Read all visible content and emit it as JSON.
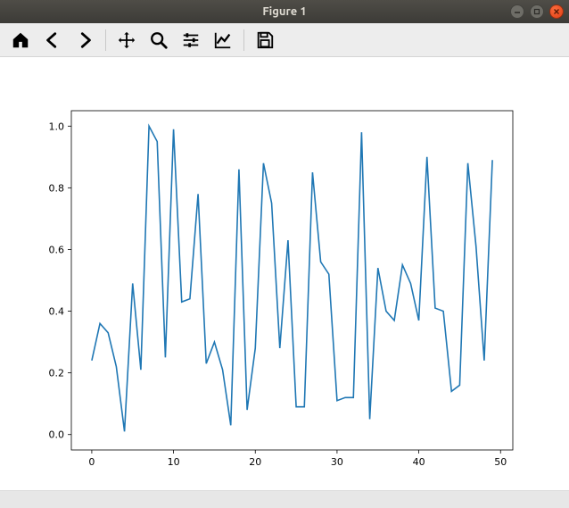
{
  "window": {
    "title": "Figure 1"
  },
  "toolbar": {
    "home_tip": "Home",
    "back_tip": "Back",
    "forward_tip": "Forward",
    "pan_tip": "Pan",
    "zoom_tip": "Zoom",
    "subplots_tip": "Configure subplots",
    "axes_tip": "Edit axis",
    "save_tip": "Save"
  },
  "chart_data": {
    "type": "line",
    "x": [
      0,
      1,
      2,
      3,
      4,
      5,
      6,
      7,
      8,
      9,
      10,
      11,
      12,
      13,
      14,
      15,
      16,
      17,
      18,
      19,
      20,
      21,
      22,
      23,
      24,
      25,
      26,
      27,
      28,
      29,
      30,
      31,
      32,
      33,
      34,
      35,
      36,
      37,
      38,
      39,
      40,
      41,
      42,
      43,
      44,
      45,
      46,
      47,
      48,
      49
    ],
    "values": [
      0.24,
      0.36,
      0.33,
      0.22,
      0.01,
      0.49,
      0.21,
      1.0,
      0.95,
      0.25,
      0.99,
      0.43,
      0.44,
      0.78,
      0.23,
      0.3,
      0.21,
      0.03,
      0.86,
      0.08,
      0.28,
      0.88,
      0.75,
      0.28,
      0.63,
      0.09,
      0.09,
      0.85,
      0.56,
      0.52,
      0.11,
      0.12,
      0.12,
      0.98,
      0.05,
      0.54,
      0.4,
      0.37,
      0.55,
      0.49,
      0.37,
      0.9,
      0.41,
      0.4,
      0.14,
      0.16,
      0.88,
      0.61,
      0.24,
      0.89
    ],
    "title": "",
    "xlabel": "",
    "ylabel": "",
    "xlim": [
      -2.5,
      51.5
    ],
    "ylim": [
      -0.05,
      1.05
    ],
    "xticks": [
      0,
      10,
      20,
      30,
      40,
      50
    ],
    "yticks": [
      0.0,
      0.2,
      0.4,
      0.6,
      0.8,
      1.0
    ],
    "xtick_labels": [
      "0",
      "10",
      "20",
      "30",
      "40",
      "50"
    ],
    "ytick_labels": [
      "0.0",
      "0.2",
      "0.4",
      "0.6",
      "0.8",
      "1.0"
    ]
  }
}
